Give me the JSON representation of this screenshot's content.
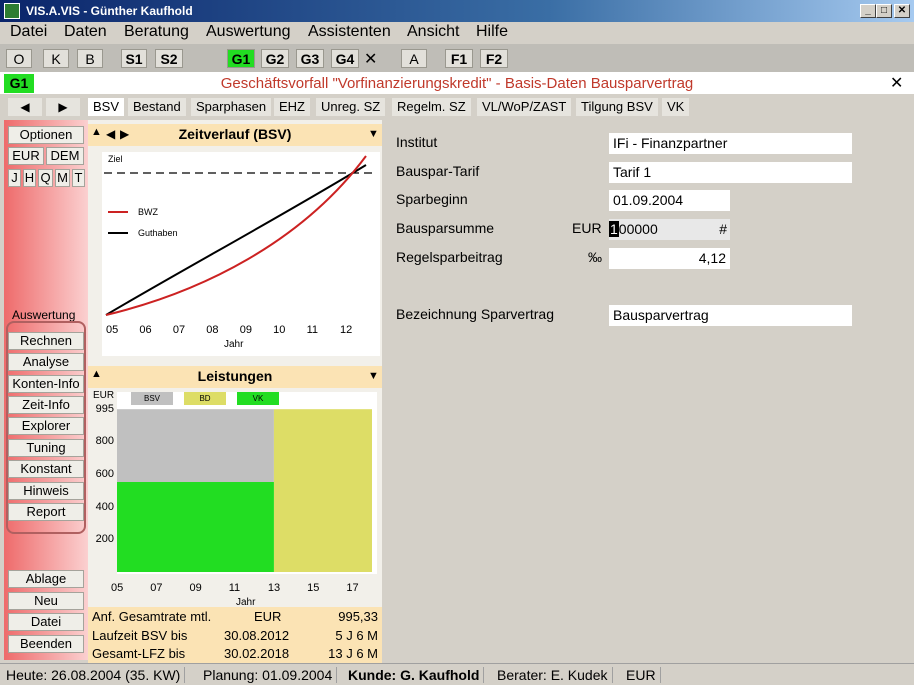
{
  "window": {
    "title": "VIS.A.VIS - Günther Kaufhold",
    "min": "_",
    "max": "□",
    "close": "✕"
  },
  "menu": [
    "Datei",
    "Daten",
    "Beratung",
    "Auswertung",
    "Assistenten",
    "Ansicht",
    "Hilfe"
  ],
  "toolbar": {
    "o": "O",
    "k": "K",
    "b": "B",
    "s1": "S1",
    "s2": "S2",
    "g1": "G1",
    "g2": "G2",
    "g3": "G3",
    "g4": "G4",
    "x": "✕",
    "a": "A",
    "f1": "F1",
    "f2": "F2"
  },
  "header": {
    "badge": "G1",
    "title": "Geschäftsvorfall \"Vorfinanzierungskredit\" - Basis-Daten Bausparvertrag",
    "close": "✕"
  },
  "tabs": [
    "BSV",
    "Bestand",
    "Sparphasen",
    "EHZ",
    "Unreg. SZ",
    "Regelm. SZ",
    "VL/WoP/ZAST",
    "Tilgung BSV",
    "VK"
  ],
  "nav": {
    "prev": "◀",
    "next": "▶"
  },
  "left": {
    "optionen": "Optionen",
    "eur": "EUR",
    "dem": "DEM",
    "periods": [
      "J",
      "H",
      "Q",
      "M",
      "T"
    ],
    "auswertung": "Auswertung",
    "buttons": [
      "Rechnen",
      "Analyse",
      "Konten-Info",
      "Zeit-Info",
      "Explorer",
      "Tuning",
      "Konstant",
      "Hinweis",
      "Report"
    ],
    "bottom": [
      "Ablage",
      "Neu",
      "Datei",
      "Beenden"
    ]
  },
  "chart1": {
    "title": "Zeitverlauf (BSV)",
    "ziel": "Ziel",
    "legend_bwz": "BWZ",
    "legend_guthaben": "Guthaben",
    "xlabel": "Jahr",
    "colors": {
      "bwz": "#cc2222",
      "guthaben": "#000000"
    }
  },
  "chart2": {
    "title": "Leistungen",
    "unit": "EUR",
    "xlabel": "Jahr",
    "legend": [
      "BSV",
      "BD",
      "VK"
    ],
    "colors": {
      "bsv": "#c0c0c0",
      "bd": "#dddd66",
      "vk": "#22dd22"
    }
  },
  "chart_data": [
    {
      "type": "line",
      "title": "Zeitverlauf (BSV)",
      "xlabel": "Jahr",
      "x": [
        "05",
        "06",
        "07",
        "08",
        "09",
        "10",
        "11",
        "12"
      ],
      "series": [
        {
          "name": "BWZ",
          "shape": "convex curve rising from start, crossing Ziel near year 12"
        },
        {
          "name": "Guthaben",
          "shape": "near-linear rise reaching Ziel near year 12"
        }
      ],
      "reference_line": "Ziel (dashed)",
      "ticks_x": [
        "05",
        "06",
        "07",
        "08",
        "09",
        "10",
        "11",
        "12"
      ]
    },
    {
      "type": "bar",
      "title": "Leistungen",
      "xlabel": "Jahr",
      "ylabel": "EUR",
      "yticks": [
        200,
        400,
        600,
        800,
        995
      ],
      "xticks": [
        "05",
        "07",
        "09",
        "11",
        "13",
        "15",
        "17"
      ],
      "series": [
        {
          "name": "BSV",
          "segments": [
            {
              "x_from": "05",
              "x_to": "13",
              "y_from": 550,
              "y_to": 995
            }
          ]
        },
        {
          "name": "BD",
          "segments": [
            {
              "x_from": "13",
              "x_to": "18",
              "y_from": 0,
              "y_to": 995
            }
          ]
        },
        {
          "name": "VK",
          "segments": [
            {
              "x_from": "05",
              "x_to": "13",
              "y_from": 0,
              "y_to": 550
            }
          ]
        }
      ]
    }
  ],
  "info": [
    {
      "label": "Anf. Gesamtrate mtl.",
      "mid": "EUR",
      "value": "995,33"
    },
    {
      "label": "Laufzeit BSV bis",
      "mid": "30.08.2012",
      "value": "5 J 6 M"
    },
    {
      "label": "Gesamt-LFZ bis",
      "mid": "30.02.2018",
      "value": "13 J 6 M"
    }
  ],
  "form": {
    "institut_label": "Institut",
    "institut": "IFi - Finanzpartner",
    "tarif_label": "Bauspar-Tarif",
    "tarif": "Tarif 1",
    "beginn_label": "Sparbeginn",
    "beginn": "01.09.2004",
    "summe_label": "Bausparsumme",
    "summe_unit": "EUR",
    "summe_cursor": "1",
    "summe": "00000",
    "summe_hash": "#",
    "regel_label": "Regelsparbeitrag",
    "regel_unit": "‰",
    "regel": "4,12",
    "bez_label": "Bezeichnung Sparvertrag",
    "bez": "Bausparvertrag"
  },
  "status": {
    "heute": "Heute: 26.08.2004 (35. KW)",
    "planung": "Planung: 01.09.2004",
    "kunde": "Kunde: G. Kaufhold",
    "berater": "Berater: E. Kudek",
    "currency": "EUR"
  }
}
